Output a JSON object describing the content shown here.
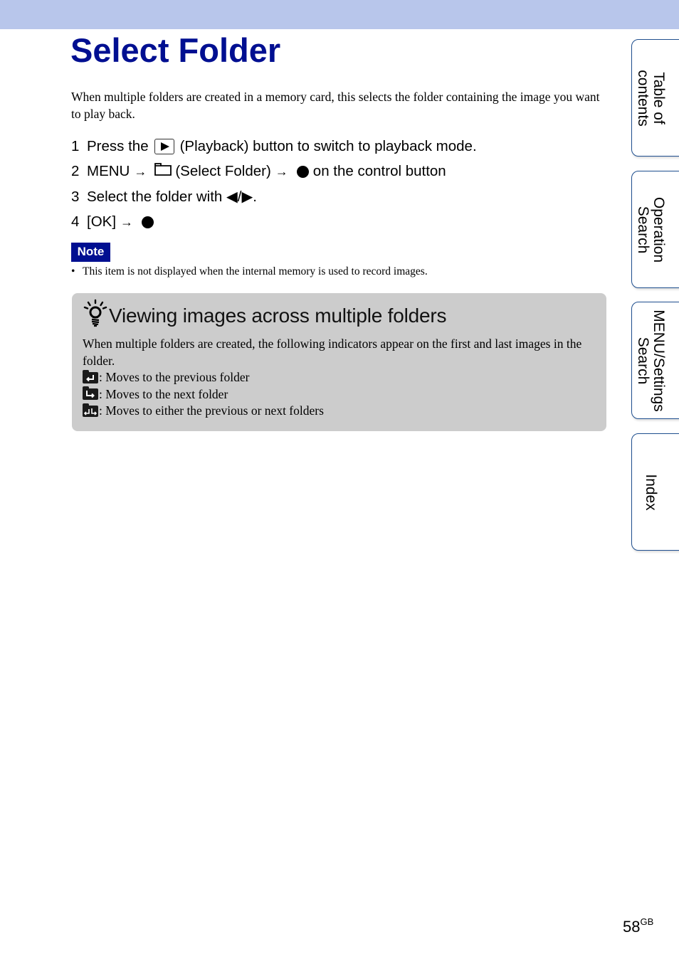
{
  "header": {
    "title": "Select Folder"
  },
  "intro": "When multiple folders are created in a memory card, this selects the folder containing the image you want to play back.",
  "steps": [
    {
      "number": "1",
      "pre": "Press the",
      "icon": "playback-icon",
      "post": "(Playback) button to switch to playback mode."
    },
    {
      "number": "2",
      "pre": "MENU",
      "arrow": "→",
      "icon": "folder-icon",
      "mid": "(Select Folder)",
      "arrow2": "→",
      "icon2": "center-button-icon",
      "post": "on the control button"
    },
    {
      "number": "3",
      "text": "Select the folder with ◀/▶."
    },
    {
      "number": "4",
      "pre": "[OK]",
      "arrow": "→",
      "icon": "center-button-icon"
    }
  ],
  "note": {
    "badge": "Note",
    "bullet": "•",
    "text": "This item is not displayed when the internal memory is used to record images."
  },
  "hint": {
    "icon": "lightbulb-icon",
    "title": "Viewing images across multiple folders",
    "body": "When multiple folders are created, the following indicators appear on the first and last images in the folder.",
    "indicators": [
      {
        "icon": "previous-folder-icon",
        "text": ": Moves to the previous folder"
      },
      {
        "icon": "next-folder-icon",
        "text": ": Moves to the next folder"
      },
      {
        "icon": "either-folder-icon",
        "text": ": Moves to either the previous or next folders"
      }
    ]
  },
  "side_tabs": [
    {
      "label_line1": "Table of",
      "label_line2": "contents"
    },
    {
      "label_line1": "Operation",
      "label_line2": "Search"
    },
    {
      "label_line1": "MENU/Settings",
      "label_line2": "Search"
    },
    {
      "label_line1": "Index",
      "label_line2": ""
    }
  ],
  "footer": {
    "page_number": "58",
    "page_suffix": "GB"
  },
  "colors": {
    "title_blue": "#000f91",
    "band_blue": "#b8c6eb",
    "hint_gray": "#cccccc",
    "tab_border": "#1f4f8f"
  }
}
